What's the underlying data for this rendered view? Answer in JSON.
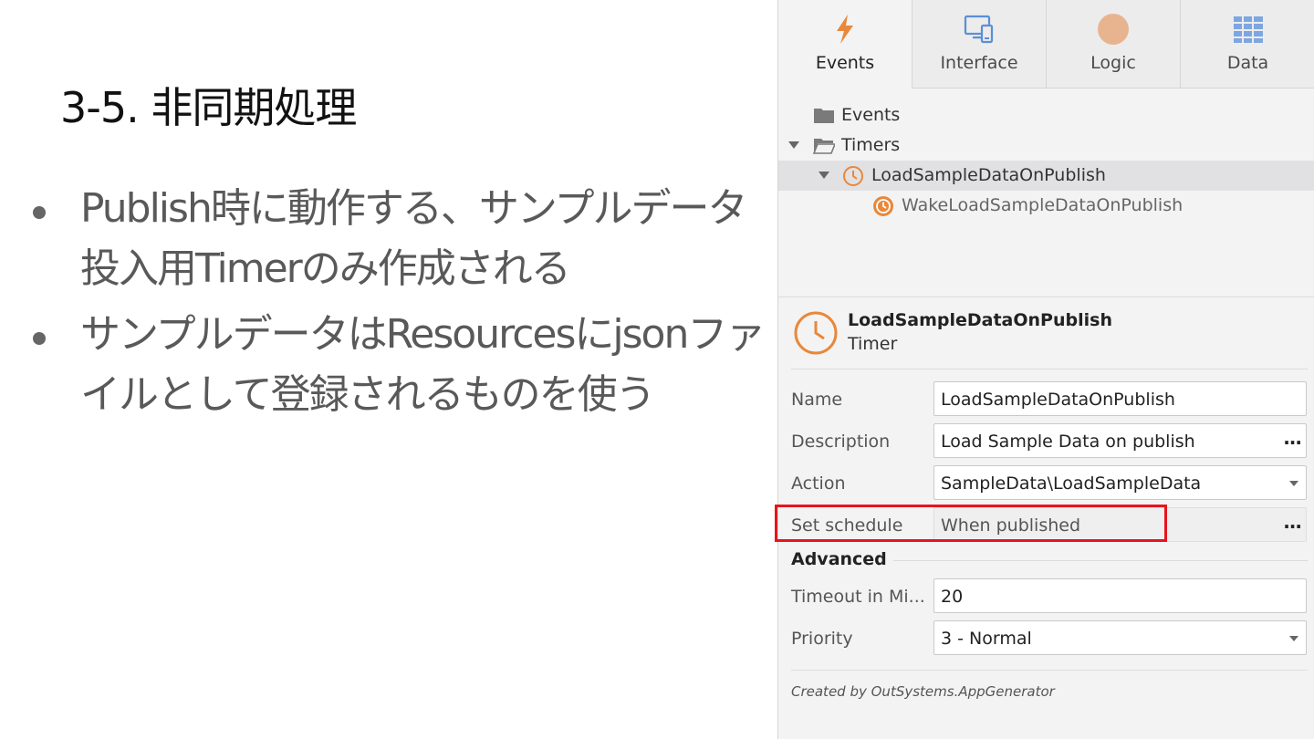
{
  "slide": {
    "title": "3-5. 非同期処理",
    "bullets": [
      {
        "lines": [
          "Publish時に動作する、サンプルデータ",
          "投入用Timerのみ作成される"
        ]
      },
      {
        "lines": [
          "サンプルデータはResourcesにjsonファ",
          "イルとして登録されるものを使う"
        ]
      }
    ]
  },
  "panel": {
    "tabs": [
      {
        "label": "Events",
        "icon": "lightning-icon",
        "active": true
      },
      {
        "label": "Interface",
        "icon": "monitor-devices-icon",
        "active": false
      },
      {
        "label": "Logic",
        "icon": "circle-icon",
        "active": false
      },
      {
        "label": "Data",
        "icon": "grid-icon",
        "active": false
      }
    ],
    "tree": {
      "events_folder": "Events",
      "timers_folder": "Timers",
      "timer": "LoadSampleDataOnPublish",
      "wake_action": "WakeLoadSampleDataOnPublish"
    },
    "properties": {
      "header_name": "LoadSampleDataOnPublish",
      "header_type": "Timer",
      "name_label": "Name",
      "name_value": "LoadSampleDataOnPublish",
      "description_label": "Description",
      "description_value": "Load Sample Data on publish",
      "action_label": "Action",
      "action_value": "SampleData\\LoadSampleData",
      "schedule_label": "Set schedule",
      "schedule_value": "When published",
      "ellipsis": "...",
      "advanced_title": "Advanced",
      "timeout_label": "Timeout in Mi...",
      "timeout_value": "20",
      "priority_label": "Priority",
      "priority_value": "3 - Normal"
    },
    "footer": "Created by OutSystems.AppGenerator"
  },
  "colors": {
    "accent_orange": "#e8883a",
    "highlight_red": "#e8141c",
    "interface_blue": "#5b8fd6",
    "logic_peach": "#e8b48f",
    "data_blue": "#7ea6e0"
  }
}
